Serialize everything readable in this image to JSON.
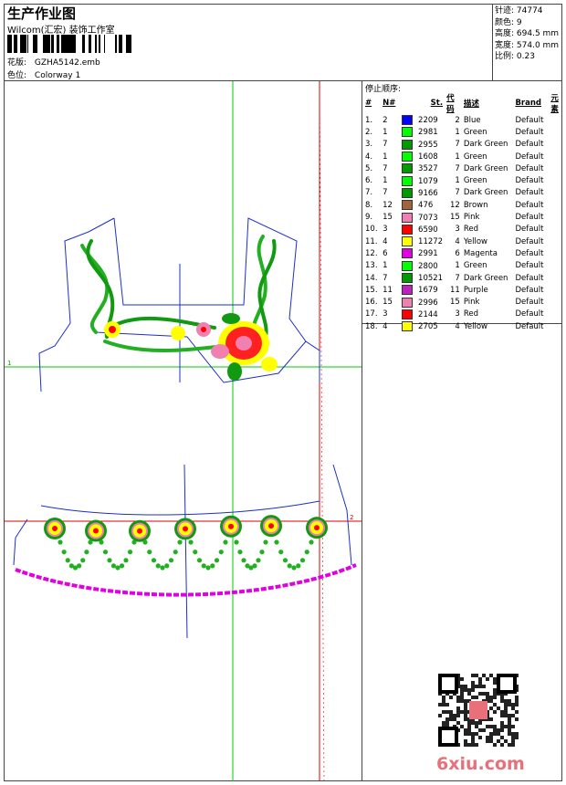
{
  "header": {
    "title": "生产作业图",
    "subtitle": "Wilcom(汇宏) 装饰工作室",
    "design_label": "花版:",
    "design_file": "GZHA5142.emb",
    "colorway_label": "色位:",
    "colorway": "Colorway 1"
  },
  "stats": [
    {
      "label": "针迹:",
      "value": "74774"
    },
    {
      "label": "颜色:",
      "value": "9"
    },
    {
      "label": "高度:",
      "value": "694.5 mm"
    },
    {
      "label": "宽度:",
      "value": "574.0 mm"
    },
    {
      "label": "比例:",
      "value": "0.23"
    }
  ],
  "sequence": {
    "title": "停止顺序:",
    "headers": [
      "#",
      "N#",
      "St.",
      "代码",
      "描述",
      "Brand",
      "元素"
    ],
    "rows": [
      {
        "idx": "1.",
        "n": "2",
        "color": "#0000ff",
        "st": "2209",
        "code": "2",
        "desc": "Blue",
        "brand": "Default"
      },
      {
        "idx": "2.",
        "n": "1",
        "color": "#00ff00",
        "st": "2981",
        "code": "1",
        "desc": "Green",
        "brand": "Default"
      },
      {
        "idx": "3.",
        "n": "7",
        "color": "#009900",
        "st": "2955",
        "code": "7",
        "desc": "Dark Green",
        "brand": "Default"
      },
      {
        "idx": "4.",
        "n": "1",
        "color": "#00ff00",
        "st": "1608",
        "code": "1",
        "desc": "Green",
        "brand": "Default"
      },
      {
        "idx": "5.",
        "n": "7",
        "color": "#009900",
        "st": "3527",
        "code": "7",
        "desc": "Dark Green",
        "brand": "Default"
      },
      {
        "idx": "6.",
        "n": "1",
        "color": "#00ff00",
        "st": "1079",
        "code": "1",
        "desc": "Green",
        "brand": "Default"
      },
      {
        "idx": "7.",
        "n": "7",
        "color": "#009900",
        "st": "9166",
        "code": "7",
        "desc": "Dark Green",
        "brand": "Default"
      },
      {
        "idx": "8.",
        "n": "12",
        "color": "#a0633c",
        "st": "476",
        "code": "12",
        "desc": "Brown",
        "brand": "Default"
      },
      {
        "idx": "9.",
        "n": "15",
        "color": "#f080b0",
        "st": "7073",
        "code": "15",
        "desc": "Pink",
        "brand": "Default"
      },
      {
        "idx": "10.",
        "n": "3",
        "color": "#ff0000",
        "st": "6590",
        "code": "3",
        "desc": "Red",
        "brand": "Default"
      },
      {
        "idx": "11.",
        "n": "4",
        "color": "#ffff00",
        "st": "11272",
        "code": "4",
        "desc": "Yellow",
        "brand": "Default"
      },
      {
        "idx": "12.",
        "n": "6",
        "color": "#e000e0",
        "st": "2991",
        "code": "6",
        "desc": "Magenta",
        "brand": "Default"
      },
      {
        "idx": "13.",
        "n": "1",
        "color": "#00ff00",
        "st": "2800",
        "code": "1",
        "desc": "Green",
        "brand": "Default"
      },
      {
        "idx": "14.",
        "n": "7",
        "color": "#009900",
        "st": "10521",
        "code": "7",
        "desc": "Dark Green",
        "brand": "Default"
      },
      {
        "idx": "15.",
        "n": "11",
        "color": "#c020c0",
        "st": "1679",
        "code": "11",
        "desc": "Purple",
        "brand": "Default"
      },
      {
        "idx": "16.",
        "n": "15",
        "color": "#f080b0",
        "st": "2996",
        "code": "15",
        "desc": "Pink",
        "brand": "Default"
      },
      {
        "idx": "17.",
        "n": "3",
        "color": "#ff0000",
        "st": "2144",
        "code": "3",
        "desc": "Red",
        "brand": "Default"
      },
      {
        "idx": "18.",
        "n": "4",
        "color": "#ffff00",
        "st": "2705",
        "code": "4",
        "desc": "Yellow",
        "brand": "Default"
      }
    ]
  },
  "canvas": {
    "axis_label_x": "1",
    "axis_label_y": "2"
  },
  "watermark": {
    "text": "6xiu.com",
    "qr_icon": "qr-code-icon",
    "color": "#e8707a"
  }
}
